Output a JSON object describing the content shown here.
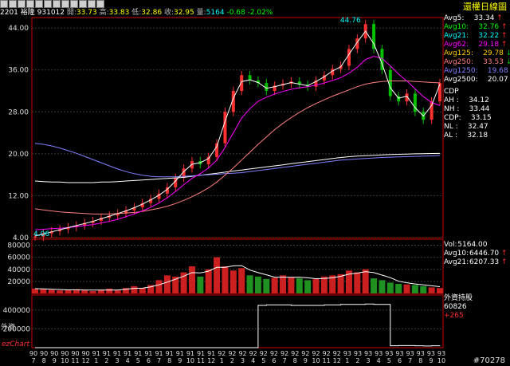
{
  "toolbar": {
    "icons": [
      "draw-icon",
      "line-icon",
      "zoom-icon",
      "period-icon",
      "cursor-icon",
      "indicator-icon",
      "compare-icon",
      "print-icon",
      "save-icon",
      "search-icon",
      "config-icon",
      "help-icon"
    ]
  },
  "quote": {
    "code": "2201 裕隆",
    "date": "931012",
    "open_label": "開:",
    "open": "33.73",
    "high_label": "高:",
    "high": "33.83",
    "low_label": "低:",
    "low": "32.86",
    "close_label": "收:",
    "close": "32.95",
    "vol_label": "量:",
    "vol": "5164",
    "change": "-0.68 -2.02%"
  },
  "chart_title": "還權日線圖",
  "price_legend": [
    {
      "label": "Avg5:",
      "value": "33.34",
      "color": "#ffffff",
      "dir": "up"
    },
    {
      "label": "Avg10:",
      "value": "32.76",
      "color": "#00ff00",
      "dir": "up"
    },
    {
      "label": "Avg21:",
      "value": "32.22",
      "color": "#00ffff",
      "dir": "up"
    },
    {
      "label": "Avg62:",
      "value": "29.18",
      "color": "#ff00ff",
      "dir": "up"
    },
    {
      "label": "Avg125:",
      "value": "29.78",
      "color": "#ffcc00",
      "dir": "dn"
    },
    {
      "label": "Avg250:",
      "value": "33.53",
      "color": "#ff8080",
      "dir": "dn"
    },
    {
      "label": "Avg1250:",
      "value": "19.68",
      "color": "#8080ff",
      "dir": "up"
    },
    {
      "label": "Avg2500:",
      "value": "20.07",
      "color": "#ffffff",
      "dir": "up"
    }
  ],
  "cdp": [
    {
      "label": "CDP",
      "value": ""
    },
    {
      "label": "AH :",
      "value": "34.12"
    },
    {
      "label": "NH :",
      "value": "33.44"
    },
    {
      "label": "CDP:",
      "value": "33.15"
    },
    {
      "label": "NL :",
      "value": "32.47"
    },
    {
      "label": "AL :",
      "value": "32.18"
    }
  ],
  "vol_legend": [
    {
      "label": "Vol:",
      "value": "5164.00",
      "color": "#ffffff",
      "dir": ""
    },
    {
      "label": "Avg10:",
      "value": "6446.70",
      "color": "#ffffff",
      "dir": "up"
    },
    {
      "label": "Avg21:",
      "value": "6207.33",
      "color": "#ffffff",
      "dir": "up"
    }
  ],
  "foreign": {
    "title": "外資持股",
    "value": "60826",
    "change": "+265",
    "side": "外資"
  },
  "brand": "ezChart",
  "footer_id": "#70278",
  "chart_data": {
    "type": "line",
    "price_axis": {
      "ylim": [
        4,
        46
      ],
      "ticks": [
        "44.00",
        "36.00",
        "28.00",
        "20.00",
        "12.00",
        "4.00"
      ],
      "tick_values": [
        44,
        36,
        28,
        20,
        12,
        4
      ]
    },
    "volume_axis": {
      "ylim": [
        0,
        90000
      ],
      "ticks": [
        "80000",
        "60000",
        "40000",
        "20000"
      ],
      "tick_values": [
        80000,
        60000,
        40000,
        20000
      ]
    },
    "holdings_axis": {
      "ylim": [
        0,
        560000
      ],
      "ticks": [
        "400000",
        "200000"
      ],
      "tick_values": [
        400000,
        200000
      ]
    },
    "annotations": {
      "max": "44.76",
      "min": "4.06"
    },
    "x_ticks": [
      {
        "yy": "90",
        "mm": "7"
      },
      {
        "yy": "90",
        "mm": "8"
      },
      {
        "yy": "90",
        "mm": "9"
      },
      {
        "yy": "90",
        "mm": "10"
      },
      {
        "yy": "90",
        "mm": "11"
      },
      {
        "yy": "90",
        "mm": "12"
      },
      {
        "yy": "91",
        "mm": "1"
      },
      {
        "yy": "91",
        "mm": "2"
      },
      {
        "yy": "91",
        "mm": "3"
      },
      {
        "yy": "91",
        "mm": "4"
      },
      {
        "yy": "91",
        "mm": "5"
      },
      {
        "yy": "91",
        "mm": "6"
      },
      {
        "yy": "91",
        "mm": "7"
      },
      {
        "yy": "91",
        "mm": "8"
      },
      {
        "yy": "91",
        "mm": "9"
      },
      {
        "yy": "91",
        "mm": "10"
      },
      {
        "yy": "91",
        "mm": "11"
      },
      {
        "yy": "91",
        "mm": "12"
      },
      {
        "yy": "92",
        "mm": "1"
      },
      {
        "yy": "92",
        "mm": "2"
      },
      {
        "yy": "92",
        "mm": "3"
      },
      {
        "yy": "92",
        "mm": "4"
      },
      {
        "yy": "92",
        "mm": "5"
      },
      {
        "yy": "92",
        "mm": "6"
      },
      {
        "yy": "92",
        "mm": "7"
      },
      {
        "yy": "92",
        "mm": "8"
      },
      {
        "yy": "92",
        "mm": "9"
      },
      {
        "yy": "92",
        "mm": "10"
      },
      {
        "yy": "92",
        "mm": "11"
      },
      {
        "yy": "92",
        "mm": "12"
      },
      {
        "yy": "93",
        "mm": "1"
      },
      {
        "yy": "93",
        "mm": "2"
      },
      {
        "yy": "93",
        "mm": "3"
      },
      {
        "yy": "93",
        "mm": "4"
      },
      {
        "yy": "93",
        "mm": "5"
      },
      {
        "yy": "93",
        "mm": "6"
      },
      {
        "yy": "93",
        "mm": "7"
      },
      {
        "yy": "93",
        "mm": "8"
      },
      {
        "yy": "93",
        "mm": "9"
      },
      {
        "yy": "93",
        "mm": "10"
      }
    ],
    "price_series": {
      "values": [
        4.2,
        4.8,
        5.2,
        5.6,
        6.0,
        6.3,
        6.8,
        7.2,
        7.8,
        8.2,
        8.6,
        9.2,
        9.8,
        10.6,
        11.4,
        12.4,
        13.6,
        15.4,
        17.2,
        18.6,
        18.0,
        19.4,
        22.0,
        28.0,
        32.0,
        35.0,
        34.0,
        33.5,
        32.0,
        33.0,
        33.4,
        33.8,
        33.2,
        32.8,
        34.0,
        35.0,
        36.2,
        36.8,
        40.0,
        42.0,
        44.76,
        40.0,
        36.0,
        31.0,
        30.0,
        31.5,
        28.0,
        26.5,
        30.0,
        33.5
      ]
    },
    "avg5_approx": [
      4.3,
      4.7,
      5.1,
      5.5,
      5.9,
      6.3,
      6.7,
      7.1,
      7.6,
      8.1,
      8.6,
      9.1,
      9.7,
      10.4,
      11.2,
      12.1,
      13.2,
      14.8,
      16.6,
      18.0,
      18.3,
      19.1,
      21.4,
      26.2,
      30.6,
      33.8,
      34.1,
      33.6,
      32.5,
      32.8,
      33.2,
      33.6,
      33.3,
      33.0,
      33.8,
      34.7,
      35.8,
      36.6,
      39.0,
      41.3,
      43.4,
      41.0,
      37.2,
      32.6,
      30.6,
      31.0,
      28.8,
      27.2,
      29.2,
      33.3
    ],
    "avg62_approx": [
      5.5,
      5.6,
      5.7,
      5.8,
      5.9,
      6.1,
      6.3,
      6.5,
      6.8,
      7.1,
      7.5,
      8.0,
      8.5,
      9.1,
      9.8,
      10.6,
      11.6,
      12.8,
      14.1,
      15.3,
      16.2,
      17.3,
      18.8,
      21.2,
      24.0,
      26.8,
      28.6,
      30.0,
      30.8,
      31.4,
      31.9,
      32.3,
      32.6,
      32.8,
      33.1,
      33.5,
      34.0,
      34.5,
      35.4,
      36.5,
      38.0,
      38.6,
      38.2,
      36.8,
      35.2,
      33.9,
      32.4,
      30.9,
      29.8,
      29.2
    ],
    "avg250_approx": [
      9.5,
      9.3,
      9.1,
      8.9,
      8.8,
      8.7,
      8.6,
      8.5,
      8.5,
      8.5,
      8.6,
      8.7,
      8.8,
      9.0,
      9.3,
      9.6,
      10.0,
      10.5,
      11.1,
      11.8,
      12.6,
      13.5,
      14.6,
      15.9,
      17.3,
      18.8,
      20.3,
      21.8,
      23.2,
      24.6,
      25.8,
      26.9,
      27.9,
      28.8,
      29.6,
      30.3,
      31.0,
      31.6,
      32.2,
      32.8,
      33.3,
      33.6,
      33.8,
      33.9,
      33.9,
      33.9,
      33.8,
      33.7,
      33.6,
      33.53
    ],
    "avg1250_approx": [
      22.0,
      21.8,
      21.5,
      21.1,
      20.6,
      20.1,
      19.5,
      18.9,
      18.3,
      17.7,
      17.1,
      16.6,
      16.2,
      15.9,
      15.7,
      15.6,
      15.6,
      15.6,
      15.7,
      15.8,
      15.9,
      16.0,
      16.1,
      16.2,
      16.3,
      16.4,
      16.6,
      16.8,
      17.0,
      17.2,
      17.4,
      17.6,
      17.8,
      18.0,
      18.2,
      18.4,
      18.6,
      18.8,
      18.9,
      19.0,
      19.1,
      19.2,
      19.3,
      19.35,
      19.4,
      19.45,
      19.5,
      19.55,
      19.6,
      19.68
    ],
    "avg2500_approx": [
      14.8,
      14.7,
      14.6,
      14.6,
      14.5,
      14.5,
      14.5,
      14.5,
      14.6,
      14.6,
      14.7,
      14.8,
      14.9,
      15.0,
      15.1,
      15.2,
      15.3,
      15.4,
      15.5,
      15.7,
      15.9,
      16.1,
      16.3,
      16.5,
      16.7,
      16.9,
      17.1,
      17.3,
      17.5,
      17.7,
      17.9,
      18.1,
      18.3,
      18.5,
      18.7,
      18.9,
      19.1,
      19.3,
      19.45,
      19.55,
      19.65,
      19.72,
      19.8,
      19.85,
      19.9,
      19.95,
      20.0,
      20.02,
      20.05,
      20.07
    ],
    "volume_approx": [
      8000,
      7000,
      6000,
      5000,
      6000,
      7000,
      5000,
      4000,
      6000,
      8000,
      5000,
      9000,
      12000,
      9000,
      14000,
      22000,
      30000,
      28000,
      35000,
      45000,
      28000,
      40000,
      60000,
      45000,
      38000,
      42000,
      30000,
      28000,
      24000,
      26000,
      30000,
      27000,
      25000,
      22000,
      24000,
      28000,
      30000,
      32000,
      38000,
      35000,
      40000,
      25000,
      22000,
      18000,
      16000,
      15000,
      14000,
      12000,
      10000,
      9000
    ],
    "holdings_approx": [
      0,
      0,
      0,
      0,
      0,
      0,
      0,
      0,
      0,
      0,
      0,
      0,
      0,
      0,
      0,
      0,
      0,
      0,
      0,
      0,
      0,
      0,
      0,
      0,
      0,
      0,
      0,
      450000,
      455000,
      455000,
      455000,
      450000,
      450000,
      450000,
      450000,
      455000,
      455000,
      460000,
      460000,
      460000,
      465000,
      460000,
      460000,
      20000,
      22000,
      22000,
      20000,
      18000,
      20000,
      21000
    ]
  }
}
